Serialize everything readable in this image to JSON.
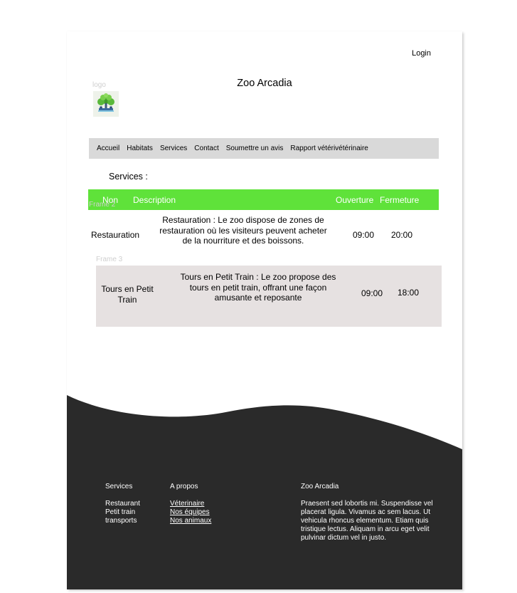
{
  "header": {
    "login_label": "Login",
    "site_title": "Zoo Arcadia",
    "logo_label": "logo"
  },
  "nav": {
    "items": [
      {
        "label": "Accueil"
      },
      {
        "label": "Habitats"
      },
      {
        "label": "Services"
      },
      {
        "label": "Contact"
      },
      {
        "label": "Soumettre un avis"
      },
      {
        "label": "Rapport vétérivétérinaire"
      }
    ]
  },
  "services": {
    "section_title": "Services :",
    "columns": {
      "nom": "Non",
      "description": "Description",
      "ouverture": "Ouverture",
      "fermeture": "Fermeture"
    },
    "frame_labels": [
      "Frame 2",
      "Frame 3"
    ],
    "rows": [
      {
        "nom": "Restauration",
        "description": "Restauration : Le zoo dispose de zones de restauration où les visiteurs peuvent acheter de la nourriture et des boissons.",
        "ouverture": "09:00",
        "fermeture": "20:00"
      },
      {
        "nom": "Tours en Petit Train",
        "description": "Tours en Petit Train : Le zoo propose des tours en petit train, offrant une façon amusante et reposante",
        "ouverture": "09:00",
        "fermeture": "18:00"
      }
    ]
  },
  "footer": {
    "services_title": "Services",
    "services_items": [
      "Restaurant",
      "Petit train",
      "transports"
    ],
    "apropos_title": "A propos",
    "apropos_links": [
      "Véterinaire",
      "Nos équipes",
      "Nos animaux"
    ],
    "brand_title": "Zoo Arcadia",
    "brand_text": "Praesent sed lobortis mi. Suspendisse vel placerat ligula. Vivamus ac sem lacus. Ut vehicula rhoncus elementum. Etiam quis tristique lectus. Aliquam in arcu eget velit pulvinar dictum vel in justo."
  },
  "colors": {
    "accent_green": "#5fe23a",
    "nav_bg": "#d9d9d9",
    "row_alt_bg": "#e6e1e1",
    "footer_bg": "#2a2a2a"
  }
}
